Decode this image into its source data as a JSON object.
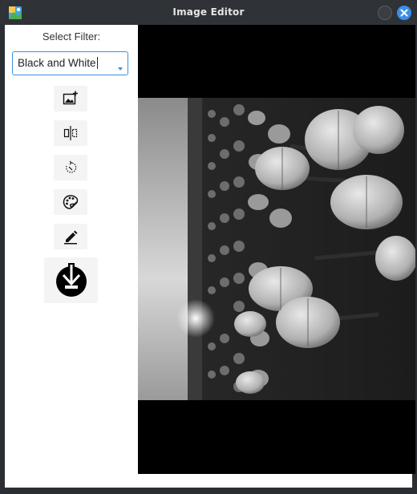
{
  "window": {
    "title": "Image Editor"
  },
  "sidebar": {
    "filter_label": "Select Filter:",
    "filter_value": "Black and White"
  },
  "tools": [
    {
      "name": "add-image",
      "icon": "add-image-icon"
    },
    {
      "name": "flip",
      "icon": "flip-icon"
    },
    {
      "name": "rotate",
      "icon": "rotate-icon"
    },
    {
      "name": "color-palette",
      "icon": "palette-icon"
    },
    {
      "name": "draw",
      "icon": "pencil-icon"
    },
    {
      "name": "save",
      "icon": "download-icon"
    }
  ],
  "canvas": {
    "image_subject": "tulip field",
    "filter_applied": "Black and White"
  },
  "colors": {
    "accent": "#3d8fe0",
    "close_button": "#3a8fe6",
    "titlebar": "#2f3237",
    "canvas_bg": "#000000"
  }
}
